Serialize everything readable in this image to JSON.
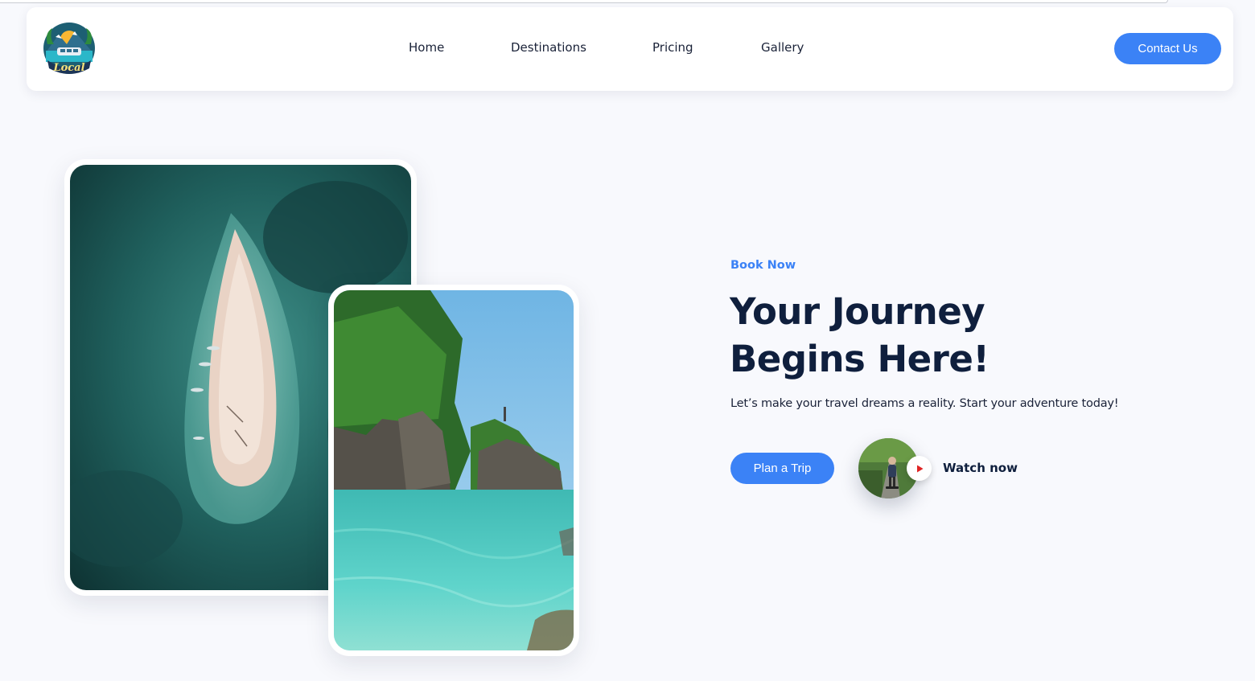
{
  "nav": {
    "logo_text": "Local",
    "links": [
      "Home",
      "Destinations",
      "Pricing",
      "Gallery"
    ],
    "contact_label": "Contact Us"
  },
  "hero": {
    "eyebrow": "Book Now",
    "title_line1": "Your Journey",
    "title_line2": "Begins Here!",
    "subtitle": "Let’s make your travel dreams a reality. Start your adventure today!",
    "plan_label": "Plan a Trip",
    "watch_label": "Watch now"
  },
  "icons": {
    "play": "play-icon",
    "logo": "local-logo-icon"
  },
  "colors": {
    "accent": "#3b82f6",
    "heading": "#0f1f3d",
    "background": "#f8f9fd",
    "play": "#e02424"
  }
}
